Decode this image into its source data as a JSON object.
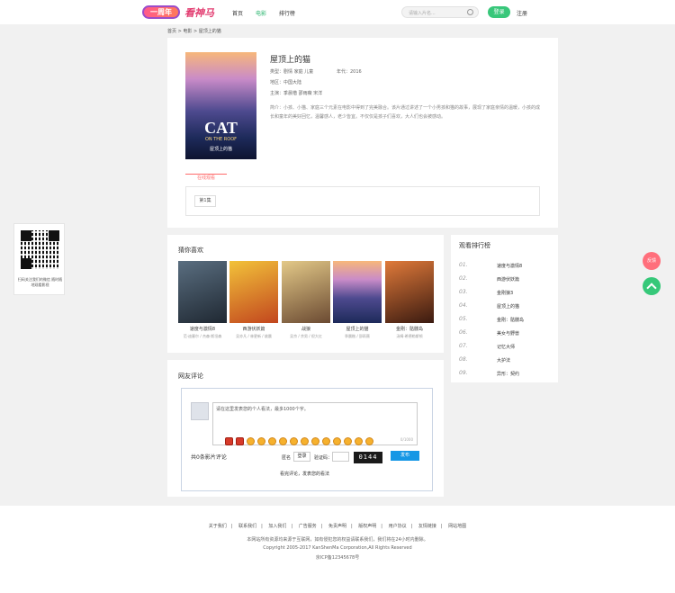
{
  "header": {
    "badge": "一周年",
    "logo": "看神马",
    "nav": [
      "首页",
      "电影",
      "排行榜"
    ],
    "nav_active_index": 1,
    "search_placeholder": "请输入片名...",
    "login": "登录",
    "register": "注册"
  },
  "breadcrumb": "首页 > 电影 > 屋顶上的猫",
  "movie": {
    "title": "屋顶上的猫",
    "poster_title": "CAT",
    "poster_sub": "ON THE ROOF",
    "poster_sub2": "屋顶上的猫",
    "type": "类型：剧情  家庭  儿童",
    "year": "年代：2016",
    "area": "地区：中国大陆",
    "director": "导演：钟智行",
    "actors": "主演：季晨楷  邵雨薇  宋洋",
    "description": "简介：小孩、小猫、家庭三个元素在电影中得到了完美融合。该片通过讲述了一个小男孩和猫的故事，展现了家庭亲情的温暖，小孩的成长和童年的美好回忆，温馨感人，老少皆宜。不仅仅是孩子们喜欢，大人们也会被感动。"
  },
  "tabs": {
    "active": "在线观看",
    "play_button": "第1集"
  },
  "guess": {
    "title": "猜你喜欢",
    "items": [
      {
        "name": "速度与激情8",
        "sub": "范·迪塞尔 / 杰森·斯坦森",
        "color": "#2c3a4a"
      },
      {
        "name": "西游伏妖篇",
        "sub": "吴亦凡 / 林更新 / 姚晨",
        "color": "#e5a12a"
      },
      {
        "name": "战狼",
        "sub": "吴京 / 余男 / 倪大红",
        "color": "#c7a36a"
      },
      {
        "name": "屋顶上的猫",
        "sub": "季晨楷 / 邵雨薇",
        "color": "#3d4a8a"
      },
      {
        "name": "金刚：骷髅岛",
        "sub": "汤姆·希德勒斯顿",
        "color": "#c54a2a"
      }
    ]
  },
  "rank": {
    "title": "观看排行榜",
    "items": [
      {
        "num": "01.",
        "name": "速度与激情8"
      },
      {
        "num": "02.",
        "name": "西游伏妖篇"
      },
      {
        "num": "03.",
        "name": "金刚狼3"
      },
      {
        "num": "04.",
        "name": "屋顶上的猫"
      },
      {
        "num": "05.",
        "name": "金刚：骷髅岛"
      },
      {
        "num": "06.",
        "name": "美女与野兽"
      },
      {
        "num": "07.",
        "name": "记忆大师"
      },
      {
        "num": "08.",
        "name": "大护法"
      },
      {
        "num": "09.",
        "name": "异形：契约"
      }
    ]
  },
  "comments": {
    "title": "网友评论",
    "placeholder": "请在这里发表您的个人看法，最多1000个字。",
    "counter": "0/1000",
    "label": "共0条影片评论",
    "anon": "匿名",
    "login_btn": "登录",
    "captcha_label": "验证码：",
    "captcha": "0144",
    "submit": "发布",
    "note": "看完评论，发表您的看法"
  },
  "qr": {
    "caption": "扫码关注我们的微信 随时随地观看影视"
  },
  "float": {
    "red": "反馈"
  },
  "footer": {
    "links": [
      "关于我们",
      "联系我们",
      "加入我们",
      "广告服务",
      "免责声明",
      "版权声明",
      "用户协议",
      "友情链接",
      "网站地图"
    ],
    "line1": "本网站所有资源均来源于互联网，如有侵犯您的权益请联系我们，我们将在24小时内删除。",
    "line2": "Copyright 2005-2017 KanShenMa Corporation,All Rights Reserved",
    "line3": "京ICP备12345678号"
  }
}
